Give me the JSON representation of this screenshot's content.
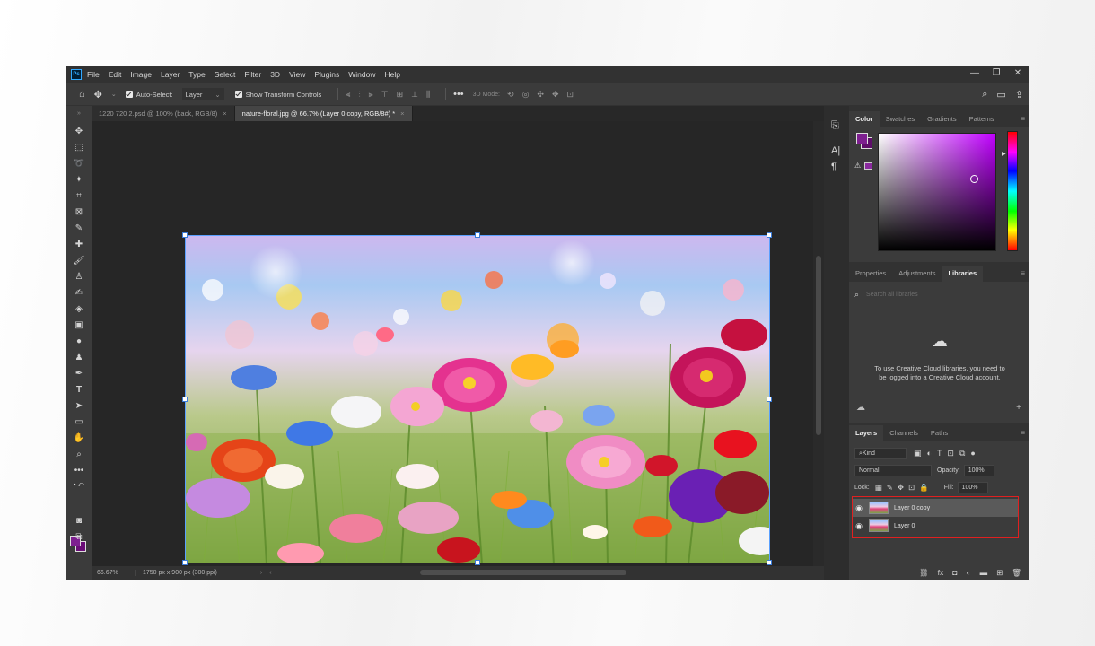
{
  "app": {
    "logo": "Ps"
  },
  "menu": [
    "File",
    "Edit",
    "Image",
    "Layer",
    "Type",
    "Select",
    "Filter",
    "3D",
    "View",
    "Plugins",
    "Window",
    "Help"
  ],
  "window_controls": [
    "—",
    "❐",
    "✕"
  ],
  "options": {
    "auto_select_label": "Auto-Select:",
    "auto_select_value": "Layer",
    "show_transform_label": "Show Transform Controls",
    "mode_label": "3D Mode:"
  },
  "tabs": [
    {
      "label": "1220 720  2.psd @ 100% (back, RGB/8)",
      "active": false
    },
    {
      "label": "nature-floral.jpg @ 66.7% (Layer 0 copy, RGB/8#) *",
      "active": true
    }
  ],
  "status": {
    "zoom": "66.67%",
    "doc_size": "1750 px x 900 px (300 ppi)"
  },
  "color_panel": {
    "tabs": [
      "Color",
      "Swatches",
      "Gradients",
      "Patterns"
    ],
    "active": "Color",
    "foreground": "#7d1f8f",
    "background": "#5e0e6a"
  },
  "libraries_panel": {
    "tabs": [
      "Properties",
      "Adjustments",
      "Libraries"
    ],
    "active": "Libraries",
    "search_placeholder": "Search all libraries",
    "message": "To use Creative Cloud libraries, you need to be logged into a Creative Cloud account."
  },
  "layers_panel": {
    "tabs": [
      "Layers",
      "Channels",
      "Paths"
    ],
    "active": "Layers",
    "filter_kind": "Kind",
    "blend_mode": "Normal",
    "opacity_label": "Opacity:",
    "opacity_value": "100%",
    "lock_label": "Lock:",
    "fill_label": "Fill:",
    "fill_value": "100%",
    "layers": [
      {
        "name": "Layer 0 copy",
        "selected": true
      },
      {
        "name": "Layer 0",
        "selected": false
      }
    ]
  },
  "colors": {
    "highlight_box": "#e02020",
    "selection_border": "#5aa0ff"
  }
}
